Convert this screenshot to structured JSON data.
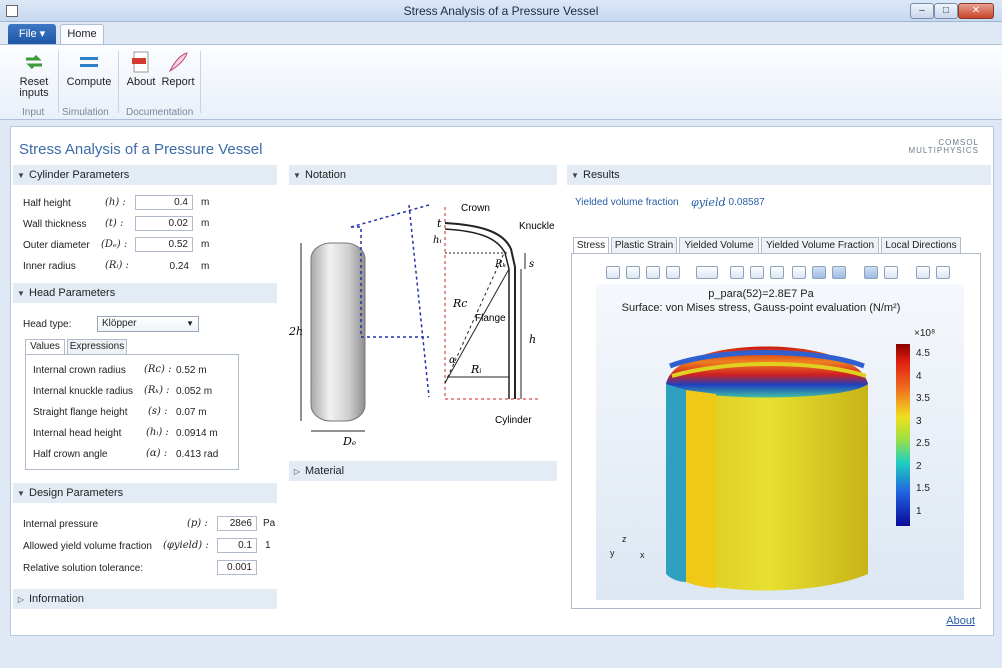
{
  "window": {
    "title": "Stress Analysis of a Pressure Vessel",
    "minimize": "–",
    "maximize": "□",
    "close": "✕"
  },
  "ribbon": {
    "file_tab": "File ▾",
    "home_tab": "Home",
    "buttons": {
      "reset": "Reset\ninputs",
      "compute": "Compute",
      "about": "About",
      "report": "Report"
    },
    "groups": {
      "input": "Input",
      "simulation": "Simulation",
      "documentation": "Documentation"
    }
  },
  "app": {
    "title": "Stress Analysis of a Pressure Vessel",
    "logo_line1": "COMSOL",
    "logo_line2": "MULTIPHYSICS"
  },
  "cylinder": {
    "header": "Cylinder Parameters",
    "rows": [
      {
        "label": "Half height",
        "sym": "(h) :",
        "value": "0.4",
        "unit": "m"
      },
      {
        "label": "Wall thickness",
        "sym": "(t) :",
        "value": "0.02",
        "unit": "m"
      },
      {
        "label": "Outer diameter",
        "sym": "(Dₑ) :",
        "value": "0.52",
        "unit": "m"
      },
      {
        "label": "Inner radius",
        "sym": "(Rᵢ) :",
        "value": "0.24",
        "unit": "m"
      }
    ]
  },
  "head": {
    "header": "Head Parameters",
    "type_label": "Head type:",
    "type_value": "Klöpper",
    "tabs": [
      "Values",
      "Expressions"
    ],
    "rows": [
      {
        "label": "Internal crown radius",
        "sym": "(Rc) :",
        "value": "0.52 m"
      },
      {
        "label": "Internal knuckle radius",
        "sym": "(Rₖ) :",
        "value": "0.052 m"
      },
      {
        "label": "Straight flange height",
        "sym": "(s) :",
        "value": "0.07 m"
      },
      {
        "label": "Internal head height",
        "sym": "(hᵢ) :",
        "value": "0.0914 m"
      },
      {
        "label": "Half crown angle",
        "sym": "(α) :",
        "value": "0.413 rad"
      }
    ]
  },
  "design": {
    "header": "Design Parameters",
    "rows": [
      {
        "label": "Internal pressure",
        "sym": "(p) :",
        "value": "28e6",
        "unit": "Pa"
      },
      {
        "label": "Allowed yield volume fraction",
        "sym": "(φyield) :",
        "value": "0.1",
        "unit": "1"
      },
      {
        "label": "Relative solution tolerance:",
        "sym": "",
        "value": "0.001",
        "unit": ""
      }
    ]
  },
  "information": {
    "header": "Information"
  },
  "notation": {
    "header": "Notation",
    "labels": {
      "crown": "Crown",
      "knuckle": "Knuckle",
      "flange": "Flange",
      "cylinder": "Cylinder",
      "two_h": "2h",
      "de": "Dₑ",
      "t": "t",
      "hi": "hᵢ",
      "rk": "Rₖ",
      "s": "s",
      "rc": "Rc",
      "h": "h",
      "ri": "Rᵢ",
      "alpha": "α"
    }
  },
  "material": {
    "header": "Material"
  },
  "results": {
    "header": "Results",
    "yield_label": "Yielded volume fraction",
    "yield_sym": "φyield",
    "yield_value": ": 0.08587",
    "tabs": [
      "Stress",
      "Plastic Strain",
      "Yielded Volume",
      "Yielded Volume Fraction",
      "Local Directions"
    ],
    "plot_title1": "p_para(52)=2.8E7 Pa",
    "plot_title2": "Surface: von Mises stress, Gauss-point evaluation (N/m²)",
    "legend": {
      "exponent": "×10⁸",
      "ticks": [
        "4.5",
        "4",
        "3.5",
        "3",
        "2.5",
        "2",
        "1.5",
        "1"
      ]
    },
    "axes": {
      "x": "x",
      "y": "y",
      "z": "z"
    }
  },
  "footer": {
    "about": "About"
  }
}
